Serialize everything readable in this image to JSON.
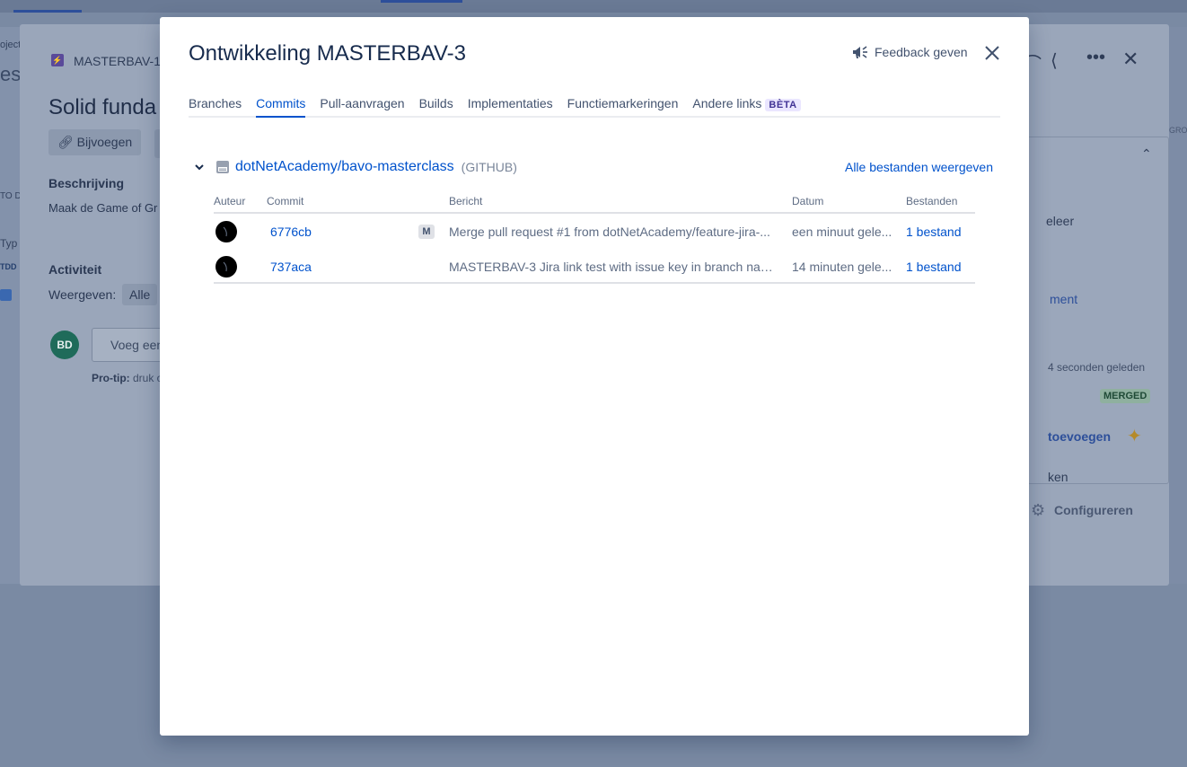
{
  "background": {
    "left_fragments": [
      "oject",
      "est",
      "TO D",
      "Typ",
      "TDD"
    ],
    "issue_key": "MASTERBAV-1",
    "issue_title": "Solid funda",
    "attach_label": "Bijvoegen",
    "description_label": "Beschrijving",
    "description_text": "Maak de Game of Gr",
    "activity_label": "Activiteit",
    "show_label": "Weergeven:",
    "show_value": "Alle",
    "avatar_initials": "BD",
    "comment_placeholder": "Voeg een",
    "protip_label": "Pro-tip:",
    "protip_text": "druk o",
    "right_fragments": {
      "deleer": "eleer",
      "comment": "ment",
      "time": "4 seconden geleden",
      "merged": "MERGED",
      "add": "toevoegen",
      "ken": "ken",
      "configure": "Configureren",
      "edge": "GROI"
    }
  },
  "modal": {
    "title": "Ontwikkeling MASTERBAV-3",
    "feedback_label": "Feedback geven",
    "tabs": [
      {
        "label": "Branches"
      },
      {
        "label": "Commits",
        "active": true
      },
      {
        "label": "Pull-aanvragen"
      },
      {
        "label": "Builds"
      },
      {
        "label": "Implementaties"
      },
      {
        "label": "Functiemarkeringen"
      },
      {
        "label": "Andere links",
        "badge": "BÈTA"
      }
    ],
    "repo": {
      "name": "dotNetAcademy/bavo-masterclass",
      "provider": "(GITHUB)",
      "all_files_label": "Alle bestanden weergeven"
    },
    "table": {
      "headers": {
        "author": "Auteur",
        "commit": "Commit",
        "message": "Bericht",
        "date": "Datum",
        "files": "Bestanden"
      },
      "rows": [
        {
          "commit": "6776cb",
          "merge_badge": "M",
          "message": "Merge pull request #1 from dotNetAcademy/feature-jira-...",
          "date": "een minuut gele...",
          "files": "1 bestand"
        },
        {
          "commit": "737aca",
          "merge_badge": "",
          "message": "MASTERBAV-3 Jira link test with issue key in branch name...",
          "date": "14 minuten gele...",
          "files": "1 bestand"
        }
      ]
    }
  },
  "colors": {
    "accent": "#0052cc",
    "title": "#172b4d",
    "muted": "#5e6c84",
    "overlay": "#5e6d87"
  }
}
